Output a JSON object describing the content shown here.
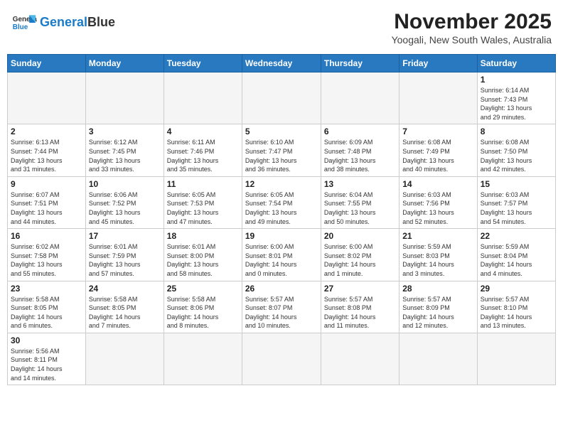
{
  "header": {
    "logo_general": "General",
    "logo_blue": "Blue",
    "month_title": "November 2025",
    "location": "Yoogali, New South Wales, Australia"
  },
  "days_of_week": [
    "Sunday",
    "Monday",
    "Tuesday",
    "Wednesday",
    "Thursday",
    "Friday",
    "Saturday"
  ],
  "weeks": [
    [
      {
        "day": "",
        "info": ""
      },
      {
        "day": "",
        "info": ""
      },
      {
        "day": "",
        "info": ""
      },
      {
        "day": "",
        "info": ""
      },
      {
        "day": "",
        "info": ""
      },
      {
        "day": "",
        "info": ""
      },
      {
        "day": "1",
        "info": "Sunrise: 6:14 AM\nSunset: 7:43 PM\nDaylight: 13 hours\nand 29 minutes."
      }
    ],
    [
      {
        "day": "2",
        "info": "Sunrise: 6:13 AM\nSunset: 7:44 PM\nDaylight: 13 hours\nand 31 minutes."
      },
      {
        "day": "3",
        "info": "Sunrise: 6:12 AM\nSunset: 7:45 PM\nDaylight: 13 hours\nand 33 minutes."
      },
      {
        "day": "4",
        "info": "Sunrise: 6:11 AM\nSunset: 7:46 PM\nDaylight: 13 hours\nand 35 minutes."
      },
      {
        "day": "5",
        "info": "Sunrise: 6:10 AM\nSunset: 7:47 PM\nDaylight: 13 hours\nand 36 minutes."
      },
      {
        "day": "6",
        "info": "Sunrise: 6:09 AM\nSunset: 7:48 PM\nDaylight: 13 hours\nand 38 minutes."
      },
      {
        "day": "7",
        "info": "Sunrise: 6:08 AM\nSunset: 7:49 PM\nDaylight: 13 hours\nand 40 minutes."
      },
      {
        "day": "8",
        "info": "Sunrise: 6:08 AM\nSunset: 7:50 PM\nDaylight: 13 hours\nand 42 minutes."
      }
    ],
    [
      {
        "day": "9",
        "info": "Sunrise: 6:07 AM\nSunset: 7:51 PM\nDaylight: 13 hours\nand 44 minutes."
      },
      {
        "day": "10",
        "info": "Sunrise: 6:06 AM\nSunset: 7:52 PM\nDaylight: 13 hours\nand 45 minutes."
      },
      {
        "day": "11",
        "info": "Sunrise: 6:05 AM\nSunset: 7:53 PM\nDaylight: 13 hours\nand 47 minutes."
      },
      {
        "day": "12",
        "info": "Sunrise: 6:05 AM\nSunset: 7:54 PM\nDaylight: 13 hours\nand 49 minutes."
      },
      {
        "day": "13",
        "info": "Sunrise: 6:04 AM\nSunset: 7:55 PM\nDaylight: 13 hours\nand 50 minutes."
      },
      {
        "day": "14",
        "info": "Sunrise: 6:03 AM\nSunset: 7:56 PM\nDaylight: 13 hours\nand 52 minutes."
      },
      {
        "day": "15",
        "info": "Sunrise: 6:03 AM\nSunset: 7:57 PM\nDaylight: 13 hours\nand 54 minutes."
      }
    ],
    [
      {
        "day": "16",
        "info": "Sunrise: 6:02 AM\nSunset: 7:58 PM\nDaylight: 13 hours\nand 55 minutes."
      },
      {
        "day": "17",
        "info": "Sunrise: 6:01 AM\nSunset: 7:59 PM\nDaylight: 13 hours\nand 57 minutes."
      },
      {
        "day": "18",
        "info": "Sunrise: 6:01 AM\nSunset: 8:00 PM\nDaylight: 13 hours\nand 58 minutes."
      },
      {
        "day": "19",
        "info": "Sunrise: 6:00 AM\nSunset: 8:01 PM\nDaylight: 14 hours\nand 0 minutes."
      },
      {
        "day": "20",
        "info": "Sunrise: 6:00 AM\nSunset: 8:02 PM\nDaylight: 14 hours\nand 1 minute."
      },
      {
        "day": "21",
        "info": "Sunrise: 5:59 AM\nSunset: 8:03 PM\nDaylight: 14 hours\nand 3 minutes."
      },
      {
        "day": "22",
        "info": "Sunrise: 5:59 AM\nSunset: 8:04 PM\nDaylight: 14 hours\nand 4 minutes."
      }
    ],
    [
      {
        "day": "23",
        "info": "Sunrise: 5:58 AM\nSunset: 8:05 PM\nDaylight: 14 hours\nand 6 minutes."
      },
      {
        "day": "24",
        "info": "Sunrise: 5:58 AM\nSunset: 8:05 PM\nDaylight: 14 hours\nand 7 minutes."
      },
      {
        "day": "25",
        "info": "Sunrise: 5:58 AM\nSunset: 8:06 PM\nDaylight: 14 hours\nand 8 minutes."
      },
      {
        "day": "26",
        "info": "Sunrise: 5:57 AM\nSunset: 8:07 PM\nDaylight: 14 hours\nand 10 minutes."
      },
      {
        "day": "27",
        "info": "Sunrise: 5:57 AM\nSunset: 8:08 PM\nDaylight: 14 hours\nand 11 minutes."
      },
      {
        "day": "28",
        "info": "Sunrise: 5:57 AM\nSunset: 8:09 PM\nDaylight: 14 hours\nand 12 minutes."
      },
      {
        "day": "29",
        "info": "Sunrise: 5:57 AM\nSunset: 8:10 PM\nDaylight: 14 hours\nand 13 minutes."
      }
    ],
    [
      {
        "day": "30",
        "info": "Sunrise: 5:56 AM\nSunset: 8:11 PM\nDaylight: 14 hours\nand 14 minutes."
      },
      {
        "day": "",
        "info": ""
      },
      {
        "day": "",
        "info": ""
      },
      {
        "day": "",
        "info": ""
      },
      {
        "day": "",
        "info": ""
      },
      {
        "day": "",
        "info": ""
      },
      {
        "day": "",
        "info": ""
      }
    ]
  ]
}
